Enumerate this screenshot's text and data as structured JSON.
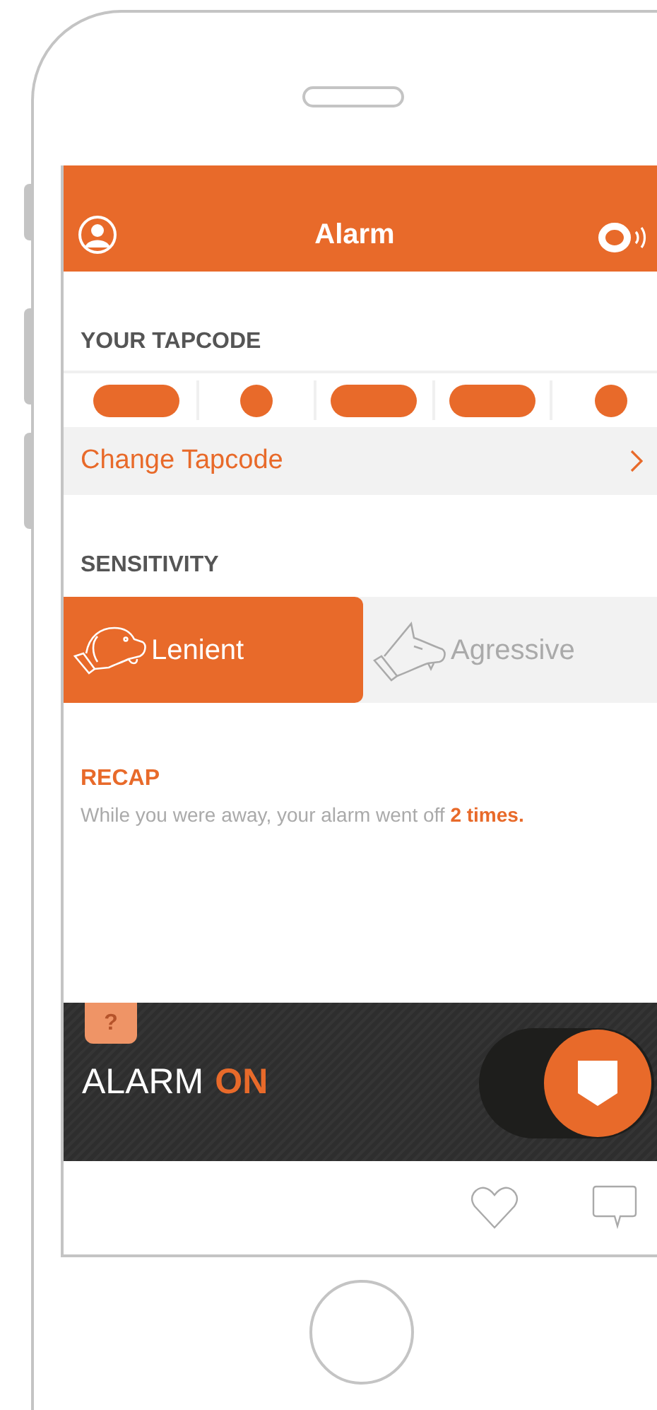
{
  "header": {
    "title": "Alarm"
  },
  "tapcode": {
    "heading": "YOUR TAPCODE",
    "segments": [
      {
        "kind": "long"
      },
      {
        "kind": "short"
      },
      {
        "kind": "long"
      },
      {
        "kind": "long"
      },
      {
        "kind": "short"
      }
    ],
    "change_label": "Change Tapcode"
  },
  "sensitivity": {
    "heading": "SENSITIVITY",
    "options": [
      {
        "label": "Lenient",
        "kind": "lenient",
        "selected": true
      },
      {
        "label": "Agressive",
        "kind": "aggressive",
        "selected": false
      }
    ]
  },
  "recap": {
    "heading": "RECAP",
    "text": "While you were away, your alarm went off **2 times.**"
  },
  "alarm": {
    "help": "?",
    "label": "ALARM",
    "state_label": "ON",
    "on": true
  }
}
